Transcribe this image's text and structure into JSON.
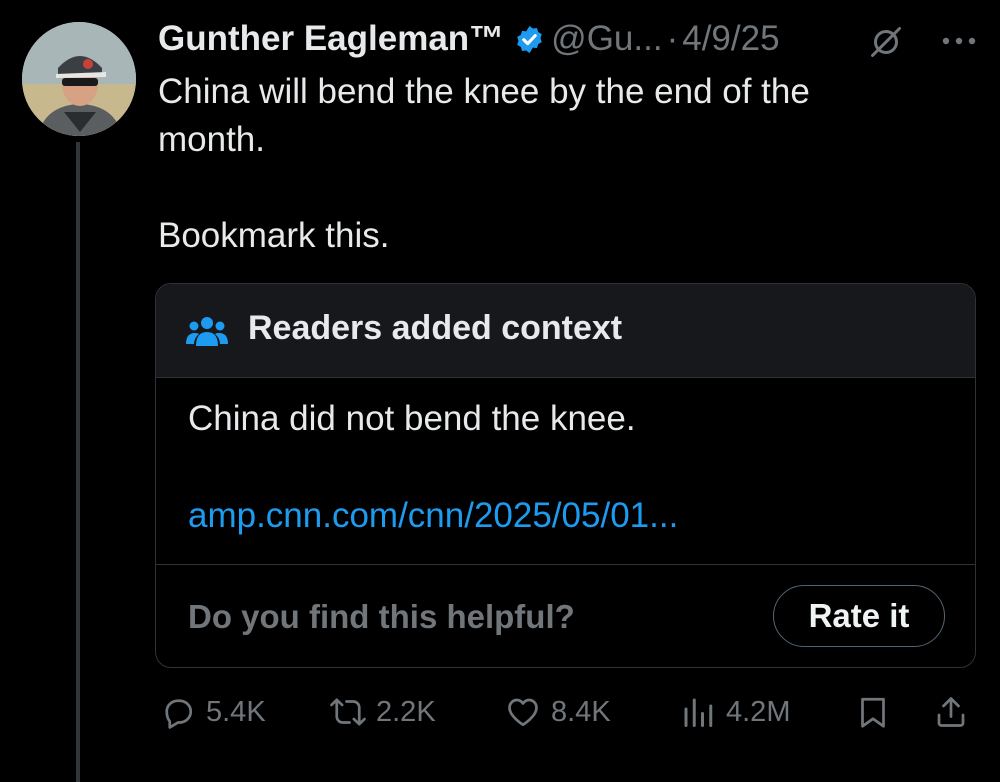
{
  "author": {
    "name": "Gunther Eagleman™",
    "handle": "@Gu...",
    "separator": "·",
    "date": "4/9/25",
    "verified_color": "#1d9bf0"
  },
  "tweet": {
    "text": "China will bend the knee by the end of the\nmonth.\n\nBookmark this."
  },
  "community_note": {
    "title": "Readers added context",
    "body": "China did not bend the knee.",
    "link": "amp.cnn.com/cnn/2025/05/01...",
    "helpful_prompt": "Do you find this helpful?",
    "rate_label": "Rate it"
  },
  "actions": {
    "replies": "5.4K",
    "reposts": "2.2K",
    "likes": "8.4K",
    "views": "4.2M"
  },
  "icons": [
    "verified-badge-icon",
    "grok-icon",
    "more-icon",
    "people-icon",
    "reply-icon",
    "repost-icon",
    "like-icon",
    "views-icon",
    "bookmark-icon",
    "share-icon"
  ],
  "colors": {
    "background": "#000000",
    "text": "#e7e9ea",
    "muted": "#71767b",
    "accent": "#1d9bf0",
    "border": "#2f3336"
  }
}
